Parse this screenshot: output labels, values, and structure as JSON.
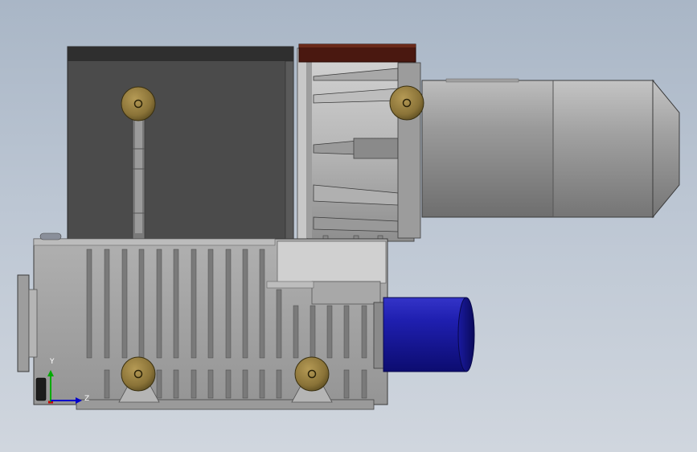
{
  "viewport": {
    "background_top": "#a9b6c6",
    "background_bottom": "#d0d6de"
  },
  "colors": {
    "upper_housing": "#4a4a4a",
    "body_gray": "#a6a6a6",
    "motor_gray": "#8f8f8f",
    "motor_blue": "#1d1da8",
    "brown_cap": "#4a1810",
    "mount_brass": "#8a7338"
  },
  "triad": {
    "y_label": "Y",
    "z_label": "Z",
    "x_color": "#cc0000",
    "y_color": "#00aa00",
    "z_color": "#0000cc"
  }
}
